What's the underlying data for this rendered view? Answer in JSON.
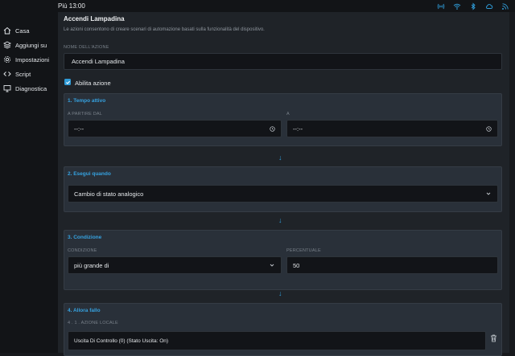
{
  "topbar": {
    "title": "Più 13:00"
  },
  "status_icons": [
    "wifi-signal-icon",
    "wifi-icon",
    "bluetooth-icon",
    "cloud-icon",
    "rss-icon"
  ],
  "sidebar": {
    "items": [
      {
        "label": "Casa",
        "icon": "home-icon"
      },
      {
        "label": "Aggiungi su",
        "icon": "layers-icon"
      },
      {
        "label": "Impostazioni",
        "icon": "gear-icon"
      },
      {
        "label": "Script",
        "icon": "code-icon"
      },
      {
        "label": "Diagnostica",
        "icon": "monitor-icon"
      }
    ]
  },
  "page": {
    "title": "Accendi Lampadina",
    "description": "Le azioni consentono di creare scenari di automazione basati sulla funzionalità del dispositivo.",
    "name_label": "NOME DELL'AZIONE",
    "name_value": "Accendi Lampadina",
    "enable_label": "Abilita azione",
    "enabled": true
  },
  "sections": {
    "active_time": {
      "title": "1. Tempo attivo",
      "from_label": "A PARTIRE DAL",
      "from_value": "--:--",
      "to_label": "A",
      "to_value": "--:--"
    },
    "execute_when": {
      "title": "2. Esegui quando",
      "value": "Cambio di stato analogico"
    },
    "condition": {
      "title": "3. Condizione",
      "condition_label": "CONDIZIONE",
      "condition_value": "più grande di",
      "percent_label": "PERCENTUALE",
      "percent_value": "50"
    },
    "then_do": {
      "title": "4. Allora fallo",
      "sub_label": "4 . 1 . AZIONE LOCALE",
      "action_value": "Uscita Di Controllo (0) (Stato Uscita: On)"
    }
  },
  "arrow_glyph": "↓",
  "colors": {
    "accent": "#2f9ad6",
    "panel": "#1f2328",
    "section": "#293039"
  }
}
